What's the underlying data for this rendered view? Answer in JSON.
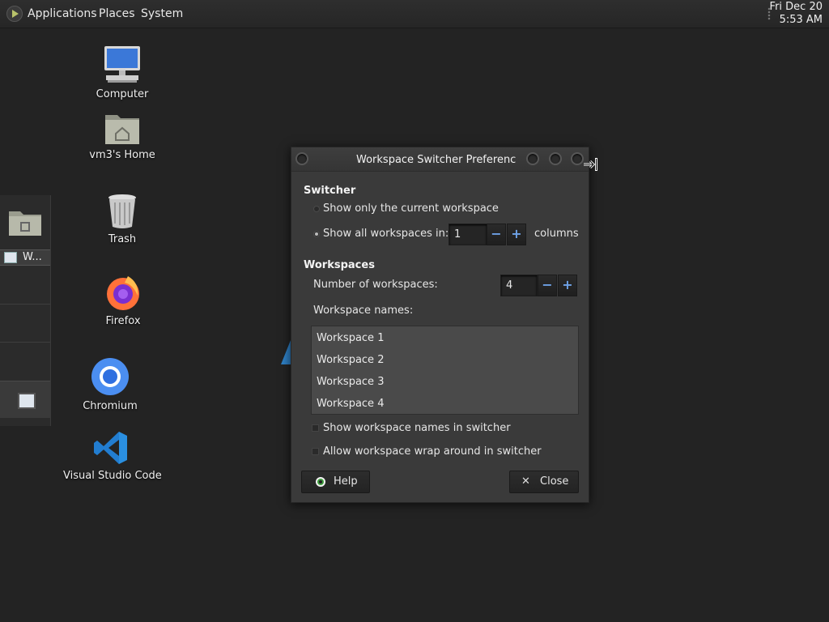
{
  "top_panel": {
    "menus": [
      "Applications",
      "Places",
      "System"
    ],
    "clock_date": "Fri Dec 20",
    "clock_time": "5:53 AM"
  },
  "left_panel": {
    "task_label": "W..."
  },
  "desktop_icons": [
    {
      "label": "Computer",
      "icon": "computer-icon"
    },
    {
      "label": "vm3's Home",
      "icon": "home-folder-icon"
    },
    {
      "label": "Trash",
      "icon": "trash-icon"
    },
    {
      "label": "Firefox",
      "icon": "firefox-icon"
    },
    {
      "label": "Chromium",
      "icon": "chromium-icon"
    },
    {
      "label": "Visual Studio Code",
      "icon": "vscode-icon"
    }
  ],
  "dialog": {
    "title": "Workspace Switcher Preferences",
    "switcher_heading": "Switcher",
    "radio_current": "Show only the current workspace",
    "radio_all": "Show all workspaces in:",
    "columns_value": "1",
    "columns_label": "columns",
    "workspaces_heading": "Workspaces",
    "num_label": "Number of workspaces:",
    "num_value": "4",
    "names_label": "Workspace names:",
    "names": [
      "Workspace 1",
      "Workspace 2",
      "Workspace 3",
      "Workspace 4"
    ],
    "check_show_names": "Show workspace names in switcher",
    "check_wrap": "Allow workspace wrap around in switcher",
    "help_label": "Help",
    "close_label": "Close",
    "spin_minus": "−",
    "spin_plus": "+",
    "close_glyph": "✕"
  },
  "colors": {
    "desktop_bg": "#232323",
    "dialog_bg": "#3a3a3a",
    "spin_accent": "#6fa3e8"
  }
}
